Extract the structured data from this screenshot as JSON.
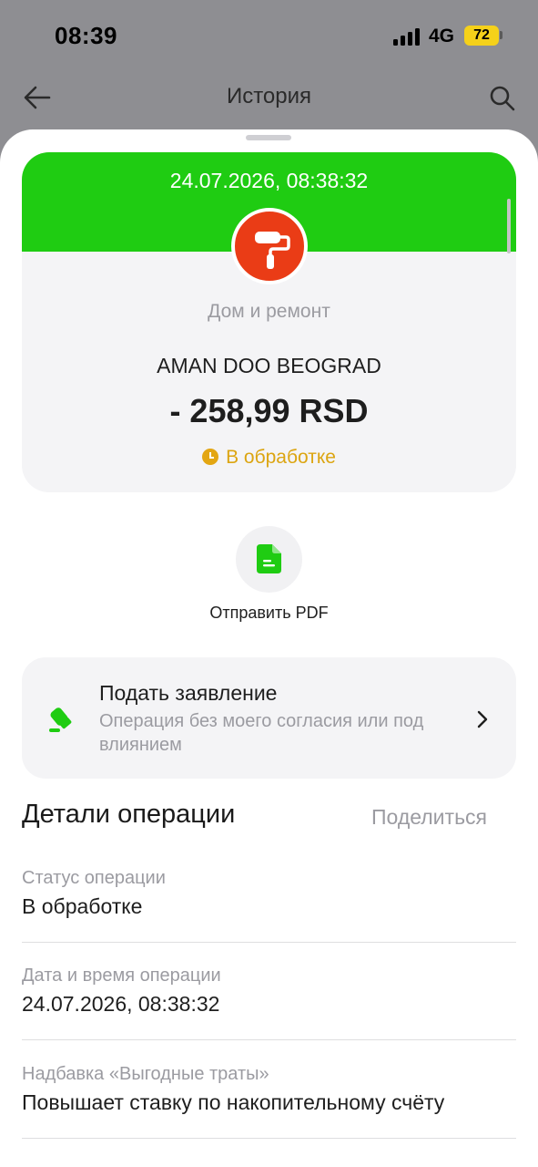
{
  "status_bar": {
    "time": "08:39",
    "network": "4G",
    "battery": "72"
  },
  "header": {
    "title": "История"
  },
  "transaction": {
    "datetime": "24.07.2026, 08:38:32",
    "category": "Дом и ремонт",
    "merchant": "AMAN DOO BEOGRAD",
    "amount": "- 258,99 RSD",
    "status": "В обработке",
    "category_icon": "paint-roller-icon"
  },
  "actions": {
    "pdf_label": "Отправить PDF",
    "pdf_icon": "document-icon"
  },
  "complaint": {
    "title": "Подать заявление",
    "subtitle": "Операция без моего согласия или под влиянием"
  },
  "details": {
    "title": "Детали операции",
    "share_label": "Поделиться",
    "rows": [
      {
        "label": "Статус операции",
        "value": "В обработке"
      },
      {
        "label": "Дата и время операции",
        "value": "24.07.2026, 08:38:32"
      },
      {
        "label": "Надбавка «Выгодные траты»",
        "value": "Повышает ставку по накопительному счёту"
      }
    ]
  },
  "colors": {
    "accent_green": "#1fcc12",
    "category_red": "#ea3c16",
    "pending_amber": "#dca511"
  }
}
